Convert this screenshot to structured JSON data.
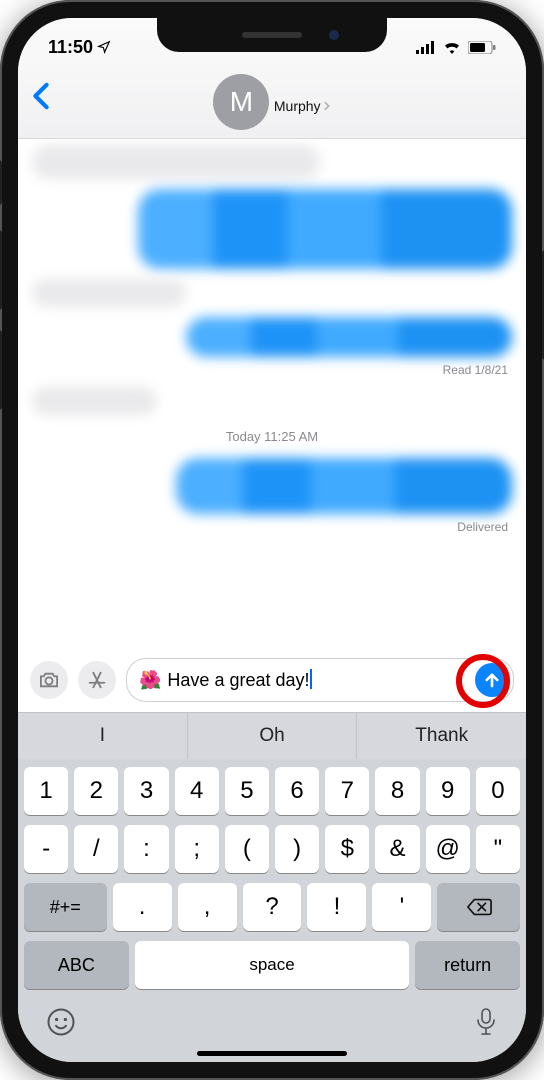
{
  "status": {
    "time": "11:50"
  },
  "header": {
    "contactInitial": "M",
    "contactName": "Murphy"
  },
  "msgMeta": {
    "read": "Read 1/8/21",
    "todayTs": "Today 11:25 AM",
    "delivered": "Delivered"
  },
  "compose": {
    "emoji": "🌺",
    "text": "Have a great day!"
  },
  "suggestions": [
    "I",
    "Oh",
    "Thank"
  ],
  "kbRow1": [
    "1",
    "2",
    "3",
    "4",
    "5",
    "6",
    "7",
    "8",
    "9",
    "0"
  ],
  "kbRow2": [
    "-",
    "/",
    ":",
    ";",
    "(",
    ")",
    "$",
    "&",
    "@",
    "\""
  ],
  "kbRow3": [
    ".",
    ",",
    "?",
    "!",
    "'"
  ],
  "shiftKey": "#+=",
  "abcKey": "ABC",
  "spaceKey": "space",
  "returnKey": "return"
}
